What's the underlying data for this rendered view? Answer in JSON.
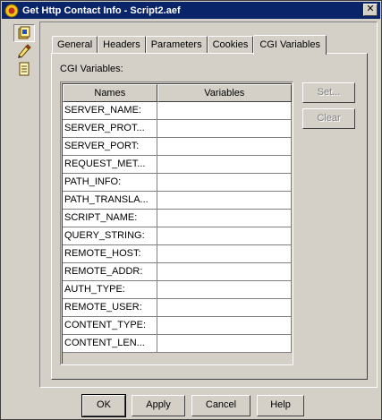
{
  "window": {
    "title": "Get Http Contact Info - Script2.aef",
    "close_glyph": "✕"
  },
  "toolbar_icons": [
    {
      "name": "step-icon"
    },
    {
      "name": "tag-edit-icon"
    },
    {
      "name": "document-icon"
    }
  ],
  "tabs": [
    {
      "label": "General",
      "active": false
    },
    {
      "label": "Headers",
      "active": false
    },
    {
      "label": "Parameters",
      "active": false
    },
    {
      "label": "Cookies",
      "active": false
    },
    {
      "label": "CGI Variables",
      "active": true
    }
  ],
  "cgi": {
    "group_label": "CGI Variables:",
    "columns": [
      "Names",
      "Variables"
    ],
    "rows": [
      {
        "name": "SERVER_NAME:",
        "variable": ""
      },
      {
        "name": "SERVER_PROT...",
        "variable": ""
      },
      {
        "name": "SERVER_PORT:",
        "variable": ""
      },
      {
        "name": "REQUEST_MET...",
        "variable": ""
      },
      {
        "name": "PATH_INFO:",
        "variable": ""
      },
      {
        "name": "PATH_TRANSLA...",
        "variable": ""
      },
      {
        "name": "SCRIPT_NAME:",
        "variable": ""
      },
      {
        "name": "QUERY_STRING:",
        "variable": ""
      },
      {
        "name": "REMOTE_HOST:",
        "variable": ""
      },
      {
        "name": "REMOTE_ADDR:",
        "variable": ""
      },
      {
        "name": "AUTH_TYPE:",
        "variable": ""
      },
      {
        "name": "REMOTE_USER:",
        "variable": ""
      },
      {
        "name": "CONTENT_TYPE:",
        "variable": ""
      },
      {
        "name": "CONTENT_LEN...",
        "variable": ""
      }
    ],
    "set_label": "Set...",
    "clear_label": "Clear"
  },
  "buttons": {
    "ok": "OK",
    "apply": "Apply",
    "cancel": "Cancel",
    "help": "Help"
  }
}
